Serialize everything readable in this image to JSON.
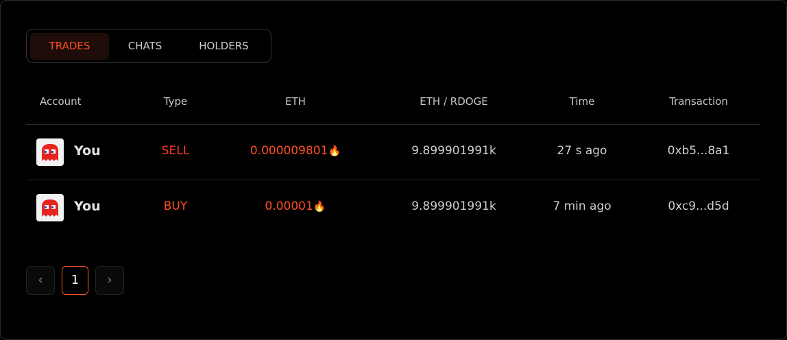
{
  "tabs": [
    {
      "label": "TRADES",
      "active": true
    },
    {
      "label": "CHATS"
    },
    {
      "label": "HOLDERS"
    }
  ],
  "table": {
    "headers": [
      "Account",
      "Type",
      "ETH",
      "ETH / RDOGE",
      "Time",
      "Transaction"
    ],
    "rows": [
      {
        "account": "You",
        "type": "SELL",
        "eth": "0.000009801",
        "price": "9.899901991k",
        "time": "27 s ago",
        "tx": "0xb5...8a1"
      },
      {
        "account": "You",
        "type": "BUY",
        "eth": "0.00001",
        "price": "9.899901991k",
        "time": "7 min ago",
        "tx": "0xc9...d5d"
      }
    ]
  },
  "pagination": {
    "prev": "‹",
    "current": "1",
    "next": "›"
  },
  "colors": {
    "accent": "#ff4d24",
    "sell": "#ff3b22",
    "buy": "#ff4d24"
  }
}
